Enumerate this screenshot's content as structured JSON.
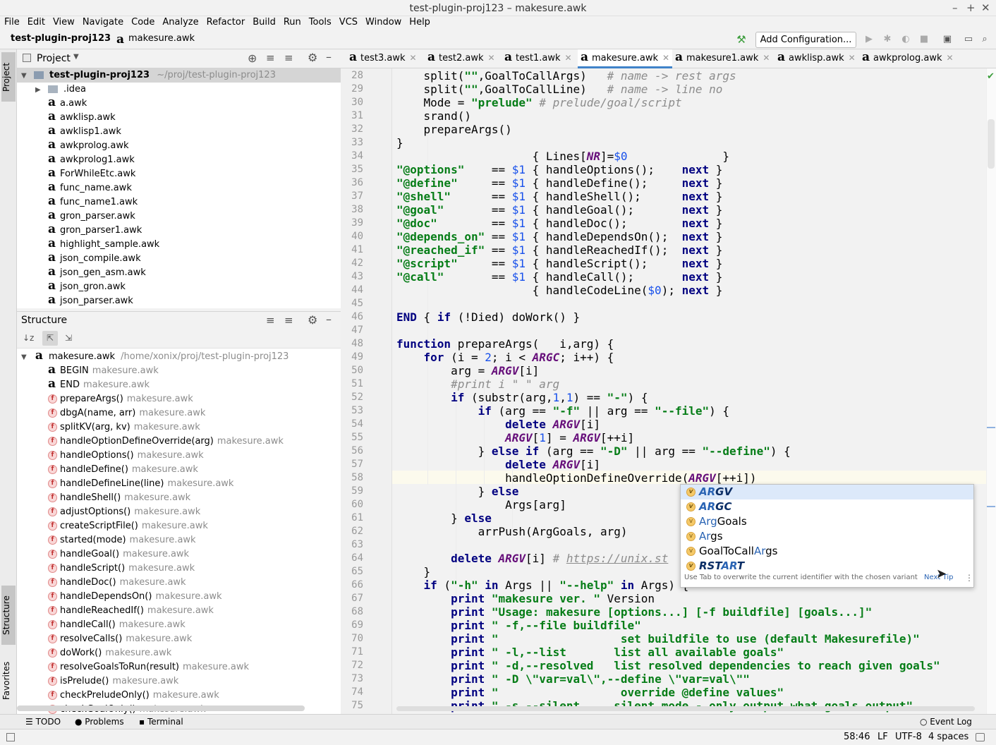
{
  "window": {
    "title": "test-plugin-proj123 – makesure.awk"
  },
  "menu": [
    "File",
    "Edit",
    "View",
    "Navigate",
    "Code",
    "Analyze",
    "Refactor",
    "Build",
    "Run",
    "Tools",
    "VCS",
    "Window",
    "Help"
  ],
  "breadcrumb": {
    "project": "test-plugin-proj123",
    "file": "makesure.awk"
  },
  "toolbar": {
    "add_configuration": "Add Configuration..."
  },
  "sidebar_tabs": {
    "project": "Project",
    "structure": "Structure",
    "favorites": "Favorites"
  },
  "project_panel": {
    "title": "Project",
    "root": "test-plugin-proj123",
    "root_path": "~/proj/test-plugin-proj123",
    "folder": ".idea",
    "files": [
      "a.awk",
      "awklisp.awk",
      "awklisp1.awk",
      "awkprolog.awk",
      "awkprolog1.awk",
      "ForWhileEtc.awk",
      "func_name.awk",
      "func_name1.awk",
      "gron_parser.awk",
      "gron_parser1.awk",
      "highlight_sample.awk",
      "json_compile.awk",
      "json_gen_asm.awk",
      "json_gron.awk",
      "json_parser.awk"
    ]
  },
  "structure_panel": {
    "title": "Structure",
    "root": "makesure.awk",
    "root_path": "/home/xonix/proj/test-plugin-proj123",
    "items": [
      {
        "kind": "a",
        "name": "BEGIN",
        "file": "makesure.awk"
      },
      {
        "kind": "a",
        "name": "END",
        "file": "makesure.awk"
      },
      {
        "kind": "f",
        "name": "prepareArgs()",
        "file": "makesure.awk"
      },
      {
        "kind": "f",
        "name": "dbgA(name, arr)",
        "file": "makesure.awk"
      },
      {
        "kind": "f",
        "name": "splitKV(arg, kv)",
        "file": "makesure.awk"
      },
      {
        "kind": "f",
        "name": "handleOptionDefineOverride(arg)",
        "file": "makesure.awk"
      },
      {
        "kind": "f",
        "name": "handleOptions()",
        "file": "makesure.awk"
      },
      {
        "kind": "f",
        "name": "handleDefine()",
        "file": "makesure.awk"
      },
      {
        "kind": "f",
        "name": "handleDefineLine(line)",
        "file": "makesure.awk"
      },
      {
        "kind": "f",
        "name": "handleShell()",
        "file": "makesure.awk"
      },
      {
        "kind": "f",
        "name": "adjustOptions()",
        "file": "makesure.awk"
      },
      {
        "kind": "f",
        "name": "createScriptFile()",
        "file": "makesure.awk"
      },
      {
        "kind": "f",
        "name": "started(mode)",
        "file": "makesure.awk"
      },
      {
        "kind": "f",
        "name": "handleGoal()",
        "file": "makesure.awk"
      },
      {
        "kind": "f",
        "name": "handleScript()",
        "file": "makesure.awk"
      },
      {
        "kind": "f",
        "name": "handleDoc()",
        "file": "makesure.awk"
      },
      {
        "kind": "f",
        "name": "handleDependsOn()",
        "file": "makesure.awk"
      },
      {
        "kind": "f",
        "name": "handleReachedIf()",
        "file": "makesure.awk"
      },
      {
        "kind": "f",
        "name": "handleCall()",
        "file": "makesure.awk"
      },
      {
        "kind": "f",
        "name": "resolveCalls()",
        "file": "makesure.awk"
      },
      {
        "kind": "f",
        "name": "doWork()",
        "file": "makesure.awk"
      },
      {
        "kind": "f",
        "name": "resolveGoalsToRun(result)",
        "file": "makesure.awk"
      },
      {
        "kind": "f",
        "name": "isPrelude()",
        "file": "makesure.awk"
      },
      {
        "kind": "f",
        "name": "checkPreludeOnly()",
        "file": "makesure.awk"
      },
      {
        "kind": "f",
        "name": "checkGoalOnly()",
        "file": "makesure.awk"
      }
    ]
  },
  "editor_tabs": [
    "test3.awk",
    "test2.awk",
    "test1.awk",
    "makesure.awk",
    "makesure1.awk",
    "awklisp.awk",
    "awkprolog.awk"
  ],
  "active_tab": "makesure.awk",
  "code_lines": [
    {
      "n": "28",
      "segs": [
        [
          "    split(",
          "p"
        ],
        [
          "\"\"",
          "s"
        ],
        [
          ",GoalToCallArgs)   ",
          "p"
        ],
        [
          "# name -> rest args",
          "c"
        ]
      ]
    },
    {
      "n": "29",
      "segs": [
        [
          "    split(",
          "p"
        ],
        [
          "\"\"",
          "s"
        ],
        [
          ",GoalToCallLine)   ",
          "p"
        ],
        [
          "# name -> line no",
          "c"
        ]
      ]
    },
    {
      "n": "30",
      "segs": [
        [
          "    Mode = ",
          "p"
        ],
        [
          "\"prelude\"",
          "s"
        ],
        [
          " ",
          "p"
        ],
        [
          "# prelude/goal/script",
          "c"
        ]
      ]
    },
    {
      "n": "31",
      "segs": [
        [
          "    srand()",
          "p"
        ]
      ]
    },
    {
      "n": "32",
      "segs": [
        [
          "    prepareArgs()",
          "p"
        ]
      ]
    },
    {
      "n": "33",
      "segs": [
        [
          "}",
          "p"
        ]
      ]
    },
    {
      "n": "34",
      "segs": [
        [
          "                    { Lines[",
          "p"
        ],
        [
          "NR",
          "v"
        ],
        [
          "]=",
          "p"
        ],
        [
          "$0",
          "n"
        ],
        [
          "              }",
          "p"
        ]
      ]
    },
    {
      "n": "35",
      "segs": [
        [
          "\"@options\"",
          "s"
        ],
        [
          "    == ",
          "p"
        ],
        [
          "$1",
          "n"
        ],
        [
          " { handleOptions();    ",
          "p"
        ],
        [
          "next",
          "k"
        ],
        [
          " }",
          "p"
        ]
      ]
    },
    {
      "n": "36",
      "segs": [
        [
          "\"@define\"",
          "s"
        ],
        [
          "     == ",
          "p"
        ],
        [
          "$1",
          "n"
        ],
        [
          " { handleDefine();     ",
          "p"
        ],
        [
          "next",
          "k"
        ],
        [
          " }",
          "p"
        ]
      ]
    },
    {
      "n": "37",
      "segs": [
        [
          "\"@shell\"",
          "s"
        ],
        [
          "      == ",
          "p"
        ],
        [
          "$1",
          "n"
        ],
        [
          " { handleShell();      ",
          "p"
        ],
        [
          "next",
          "k"
        ],
        [
          " }",
          "p"
        ]
      ]
    },
    {
      "n": "38",
      "segs": [
        [
          "\"@goal\"",
          "s"
        ],
        [
          "       == ",
          "p"
        ],
        [
          "$1",
          "n"
        ],
        [
          " { handleGoal();       ",
          "p"
        ],
        [
          "next",
          "k"
        ],
        [
          " }",
          "p"
        ]
      ]
    },
    {
      "n": "39",
      "segs": [
        [
          "\"@doc\"",
          "s"
        ],
        [
          "        == ",
          "p"
        ],
        [
          "$1",
          "n"
        ],
        [
          " { handleDoc();        ",
          "p"
        ],
        [
          "next",
          "k"
        ],
        [
          " }",
          "p"
        ]
      ]
    },
    {
      "n": "40",
      "segs": [
        [
          "\"@depends_on\"",
          "s"
        ],
        [
          " == ",
          "p"
        ],
        [
          "$1",
          "n"
        ],
        [
          " { handleDependsOn();  ",
          "p"
        ],
        [
          "next",
          "k"
        ],
        [
          " }",
          "p"
        ]
      ]
    },
    {
      "n": "41",
      "segs": [
        [
          "\"@reached_if\"",
          "s"
        ],
        [
          " == ",
          "p"
        ],
        [
          "$1",
          "n"
        ],
        [
          " { handleReachedIf();  ",
          "p"
        ],
        [
          "next",
          "k"
        ],
        [
          " }",
          "p"
        ]
      ]
    },
    {
      "n": "42",
      "segs": [
        [
          "\"@script\"",
          "s"
        ],
        [
          "     == ",
          "p"
        ],
        [
          "$1",
          "n"
        ],
        [
          " { handleScript();     ",
          "p"
        ],
        [
          "next",
          "k"
        ],
        [
          " }",
          "p"
        ]
      ]
    },
    {
      "n": "43",
      "segs": [
        [
          "\"@call\"",
          "s"
        ],
        [
          "       == ",
          "p"
        ],
        [
          "$1",
          "n"
        ],
        [
          " { handleCall();       ",
          "p"
        ],
        [
          "next",
          "k"
        ],
        [
          " }",
          "p"
        ]
      ]
    },
    {
      "n": "44",
      "segs": [
        [
          "                    { handleCodeLine(",
          "p"
        ],
        [
          "$0",
          "n"
        ],
        [
          "); ",
          "p"
        ],
        [
          "next",
          "k"
        ],
        [
          " }",
          "p"
        ]
      ]
    },
    {
      "n": "45",
      "segs": []
    },
    {
      "n": "46",
      "segs": [
        [
          "END",
          "k"
        ],
        [
          " { ",
          "p"
        ],
        [
          "if",
          "k"
        ],
        [
          " (!Died) doWork() }",
          "p"
        ]
      ]
    },
    {
      "n": "47",
      "segs": []
    },
    {
      "n": "48",
      "segs": [
        [
          "function",
          "k"
        ],
        [
          " prepareArgs(   i,arg) {",
          "p"
        ]
      ]
    },
    {
      "n": "49",
      "segs": [
        [
          "    ",
          "p"
        ],
        [
          "for",
          "k"
        ],
        [
          " (i = ",
          "p"
        ],
        [
          "2",
          "n"
        ],
        [
          "; i < ",
          "p"
        ],
        [
          "ARGC",
          "v"
        ],
        [
          "; i++) {",
          "p"
        ]
      ]
    },
    {
      "n": "50",
      "segs": [
        [
          "        arg = ",
          "p"
        ],
        [
          "ARGV",
          "v"
        ],
        [
          "[i]",
          "p"
        ]
      ]
    },
    {
      "n": "51",
      "segs": [
        [
          "        ",
          "p"
        ],
        [
          "#print i \" \" arg",
          "c"
        ]
      ]
    },
    {
      "n": "52",
      "segs": [
        [
          "        ",
          "p"
        ],
        [
          "if",
          "k"
        ],
        [
          " (substr(arg,",
          "p"
        ],
        [
          "1",
          "n"
        ],
        [
          ",",
          "p"
        ],
        [
          "1",
          "n"
        ],
        [
          ") == ",
          "p"
        ],
        [
          "\"-\"",
          "s"
        ],
        [
          ") {",
          "p"
        ]
      ]
    },
    {
      "n": "53",
      "segs": [
        [
          "            ",
          "p"
        ],
        [
          "if",
          "k"
        ],
        [
          " (arg == ",
          "p"
        ],
        [
          "\"-f\"",
          "s"
        ],
        [
          " || arg == ",
          "p"
        ],
        [
          "\"--file\"",
          "s"
        ],
        [
          ") {",
          "p"
        ]
      ]
    },
    {
      "n": "54",
      "segs": [
        [
          "                ",
          "p"
        ],
        [
          "delete",
          "k"
        ],
        [
          " ",
          "p"
        ],
        [
          "ARGV",
          "v"
        ],
        [
          "[i]",
          "p"
        ]
      ]
    },
    {
      "n": "55",
      "segs": [
        [
          "                ",
          "p"
        ],
        [
          "ARGV",
          "v"
        ],
        [
          "[",
          "p"
        ],
        [
          "1",
          "n"
        ],
        [
          "] = ",
          "p"
        ],
        [
          "ARGV",
          "v"
        ],
        [
          "[++i]",
          "p"
        ]
      ]
    },
    {
      "n": "56",
      "segs": [
        [
          "            } ",
          "p"
        ],
        [
          "else if",
          "k"
        ],
        [
          " (arg == ",
          "p"
        ],
        [
          "\"-D\"",
          "s"
        ],
        [
          " || arg == ",
          "p"
        ],
        [
          "\"--define\"",
          "s"
        ],
        [
          ") {",
          "p"
        ]
      ]
    },
    {
      "n": "57",
      "segs": [
        [
          "                ",
          "p"
        ],
        [
          "delete",
          "k"
        ],
        [
          " ",
          "p"
        ],
        [
          "ARGV",
          "v"
        ],
        [
          "[i]",
          "p"
        ]
      ]
    },
    {
      "n": "58",
      "segs": [
        [
          "                handleOptionDefineOverride(",
          "p"
        ],
        [
          "ARGV",
          "v"
        ],
        [
          "[++i])",
          "p"
        ]
      ]
    },
    {
      "n": "59",
      "segs": [
        [
          "            } ",
          "p"
        ],
        [
          "else",
          "k"
        ]
      ]
    },
    {
      "n": "60",
      "segs": [
        [
          "                Args[arg]",
          "p"
        ]
      ]
    },
    {
      "n": "61",
      "segs": [
        [
          "        } ",
          "p"
        ],
        [
          "else",
          "k"
        ]
      ]
    },
    {
      "n": "62",
      "segs": [
        [
          "            arrPush(ArgGoals, arg)",
          "p"
        ]
      ]
    },
    {
      "n": "63",
      "segs": []
    },
    {
      "n": "64",
      "segs": [
        [
          "        ",
          "p"
        ],
        [
          "delete",
          "k"
        ],
        [
          " ",
          "p"
        ],
        [
          "ARGV",
          "v"
        ],
        [
          "[i] ",
          "p"
        ],
        [
          "# ",
          "c"
        ],
        [
          "https://unix.st",
          "l"
        ]
      ]
    },
    {
      "n": "65",
      "segs": [
        [
          "    }",
          "p"
        ]
      ]
    },
    {
      "n": "66",
      "segs": [
        [
          "    ",
          "p"
        ],
        [
          "if",
          "k"
        ],
        [
          " (",
          "p"
        ],
        [
          "\"-h\"",
          "s"
        ],
        [
          " ",
          "p"
        ],
        [
          "in",
          "k"
        ],
        [
          " Args || ",
          "p"
        ],
        [
          "\"--help\"",
          "s"
        ],
        [
          " ",
          "p"
        ],
        [
          "in",
          "k"
        ],
        [
          " Args) {",
          "p"
        ]
      ]
    },
    {
      "n": "67",
      "segs": [
        [
          "        ",
          "p"
        ],
        [
          "print",
          "k"
        ],
        [
          " ",
          "p"
        ],
        [
          "\"makesure ver. \"",
          "s"
        ],
        [
          " Version",
          "p"
        ]
      ]
    },
    {
      "n": "68",
      "segs": [
        [
          "        ",
          "p"
        ],
        [
          "print",
          "k"
        ],
        [
          " ",
          "p"
        ],
        [
          "\"Usage: makesure [options...] [-f buildfile] [goals...]\"",
          "s"
        ]
      ]
    },
    {
      "n": "69",
      "segs": [
        [
          "        ",
          "p"
        ],
        [
          "print",
          "k"
        ],
        [
          " ",
          "p"
        ],
        [
          "\" -f,--file buildfile\"",
          "s"
        ]
      ]
    },
    {
      "n": "70",
      "segs": [
        [
          "        ",
          "p"
        ],
        [
          "print",
          "k"
        ],
        [
          " ",
          "p"
        ],
        [
          "\"                  set buildfile to use (default Makesurefile)\"",
          "s"
        ]
      ]
    },
    {
      "n": "71",
      "segs": [
        [
          "        ",
          "p"
        ],
        [
          "print",
          "k"
        ],
        [
          " ",
          "p"
        ],
        [
          "\" -l,--list       list all available goals\"",
          "s"
        ]
      ]
    },
    {
      "n": "72",
      "segs": [
        [
          "        ",
          "p"
        ],
        [
          "print",
          "k"
        ],
        [
          " ",
          "p"
        ],
        [
          "\" -d,--resolved   list resolved dependencies to reach given goals\"",
          "s"
        ]
      ]
    },
    {
      "n": "73",
      "segs": [
        [
          "        ",
          "p"
        ],
        [
          "print",
          "k"
        ],
        [
          " ",
          "p"
        ],
        [
          "\" -D \\\"var=val\\\",--define \\\"var=val\\\"\"",
          "s"
        ]
      ]
    },
    {
      "n": "74",
      "segs": [
        [
          "        ",
          "p"
        ],
        [
          "print",
          "k"
        ],
        [
          " ",
          "p"
        ],
        [
          "\"                  override @define values\"",
          "s"
        ]
      ]
    },
    {
      "n": "75",
      "segs": [
        [
          "        ",
          "p"
        ],
        [
          "print",
          "k"
        ],
        [
          " ",
          "p"
        ],
        [
          "\" -s,--silent     silent mode - only output what goals output\"",
          "s"
        ]
      ]
    }
  ],
  "completion": {
    "items": [
      {
        "match": "AR",
        "rest": "GV",
        "style": "bi"
      },
      {
        "match": "AR",
        "rest": "GC",
        "style": "bi"
      },
      {
        "pre": "",
        "match": "Arg",
        "rest": "Goals",
        "style": "n"
      },
      {
        "pre": "",
        "match": "Ar",
        "rest": "gs",
        "style": "n"
      },
      {
        "pre": "GoalToCall",
        "match": "Ar",
        "rest": "gs",
        "style": "n"
      },
      {
        "pre": "RST",
        "match": "AR",
        "rest": "T",
        "style": "bi"
      }
    ],
    "hint": "Use Tab to overwrite the current identifier with the chosen variant",
    "next_tip": "Next Tip"
  },
  "bottom_tabs": {
    "todo": "TODO",
    "problems": "Problems",
    "terminal": "Terminal",
    "event_log": "Event Log"
  },
  "status": {
    "position": "58:46",
    "line_sep": "LF",
    "encoding": "UTF-8",
    "indent": "4 spaces"
  }
}
